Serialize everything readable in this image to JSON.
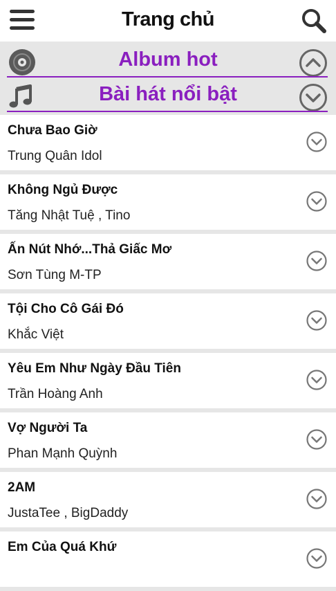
{
  "header": {
    "title": "Trang chủ",
    "menu_icon": "hamburger-menu-icon",
    "search_icon": "search-icon"
  },
  "sections": [
    {
      "title": "Album hot",
      "icon": "disc-icon",
      "toggle_icon": "chevron-up-circle-icon"
    },
    {
      "title": "Bài hát nổi bật",
      "icon": "music-note-icon",
      "toggle_icon": "chevron-down-circle-icon"
    }
  ],
  "songs": [
    {
      "title": "Chưa Bao Giờ",
      "artist": "Trung Quân Idol"
    },
    {
      "title": "Không Ngủ Được",
      "artist": "Tăng Nhật Tuệ , Tino"
    },
    {
      "title": "Ấn Nút Nhớ...Thả Giấc Mơ",
      "artist": "Sơn Tùng M-TP"
    },
    {
      "title": "Tội Cho Cô Gái Đó",
      "artist": "Khắc Việt"
    },
    {
      "title": "Yêu Em Như Ngày Đầu Tiên",
      "artist": "Trần Hoàng Anh"
    },
    {
      "title": "Vợ Người Ta",
      "artist": "Phan Mạnh Quỳnh"
    },
    {
      "title": "2AM",
      "artist": "JustaTee , BigDaddy"
    },
    {
      "title": "Em Của Quá Khứ",
      "artist": ""
    }
  ],
  "colors": {
    "accent": "#8a1fbf",
    "background": "#e6e6e6",
    "icon_gray": "#555555"
  }
}
